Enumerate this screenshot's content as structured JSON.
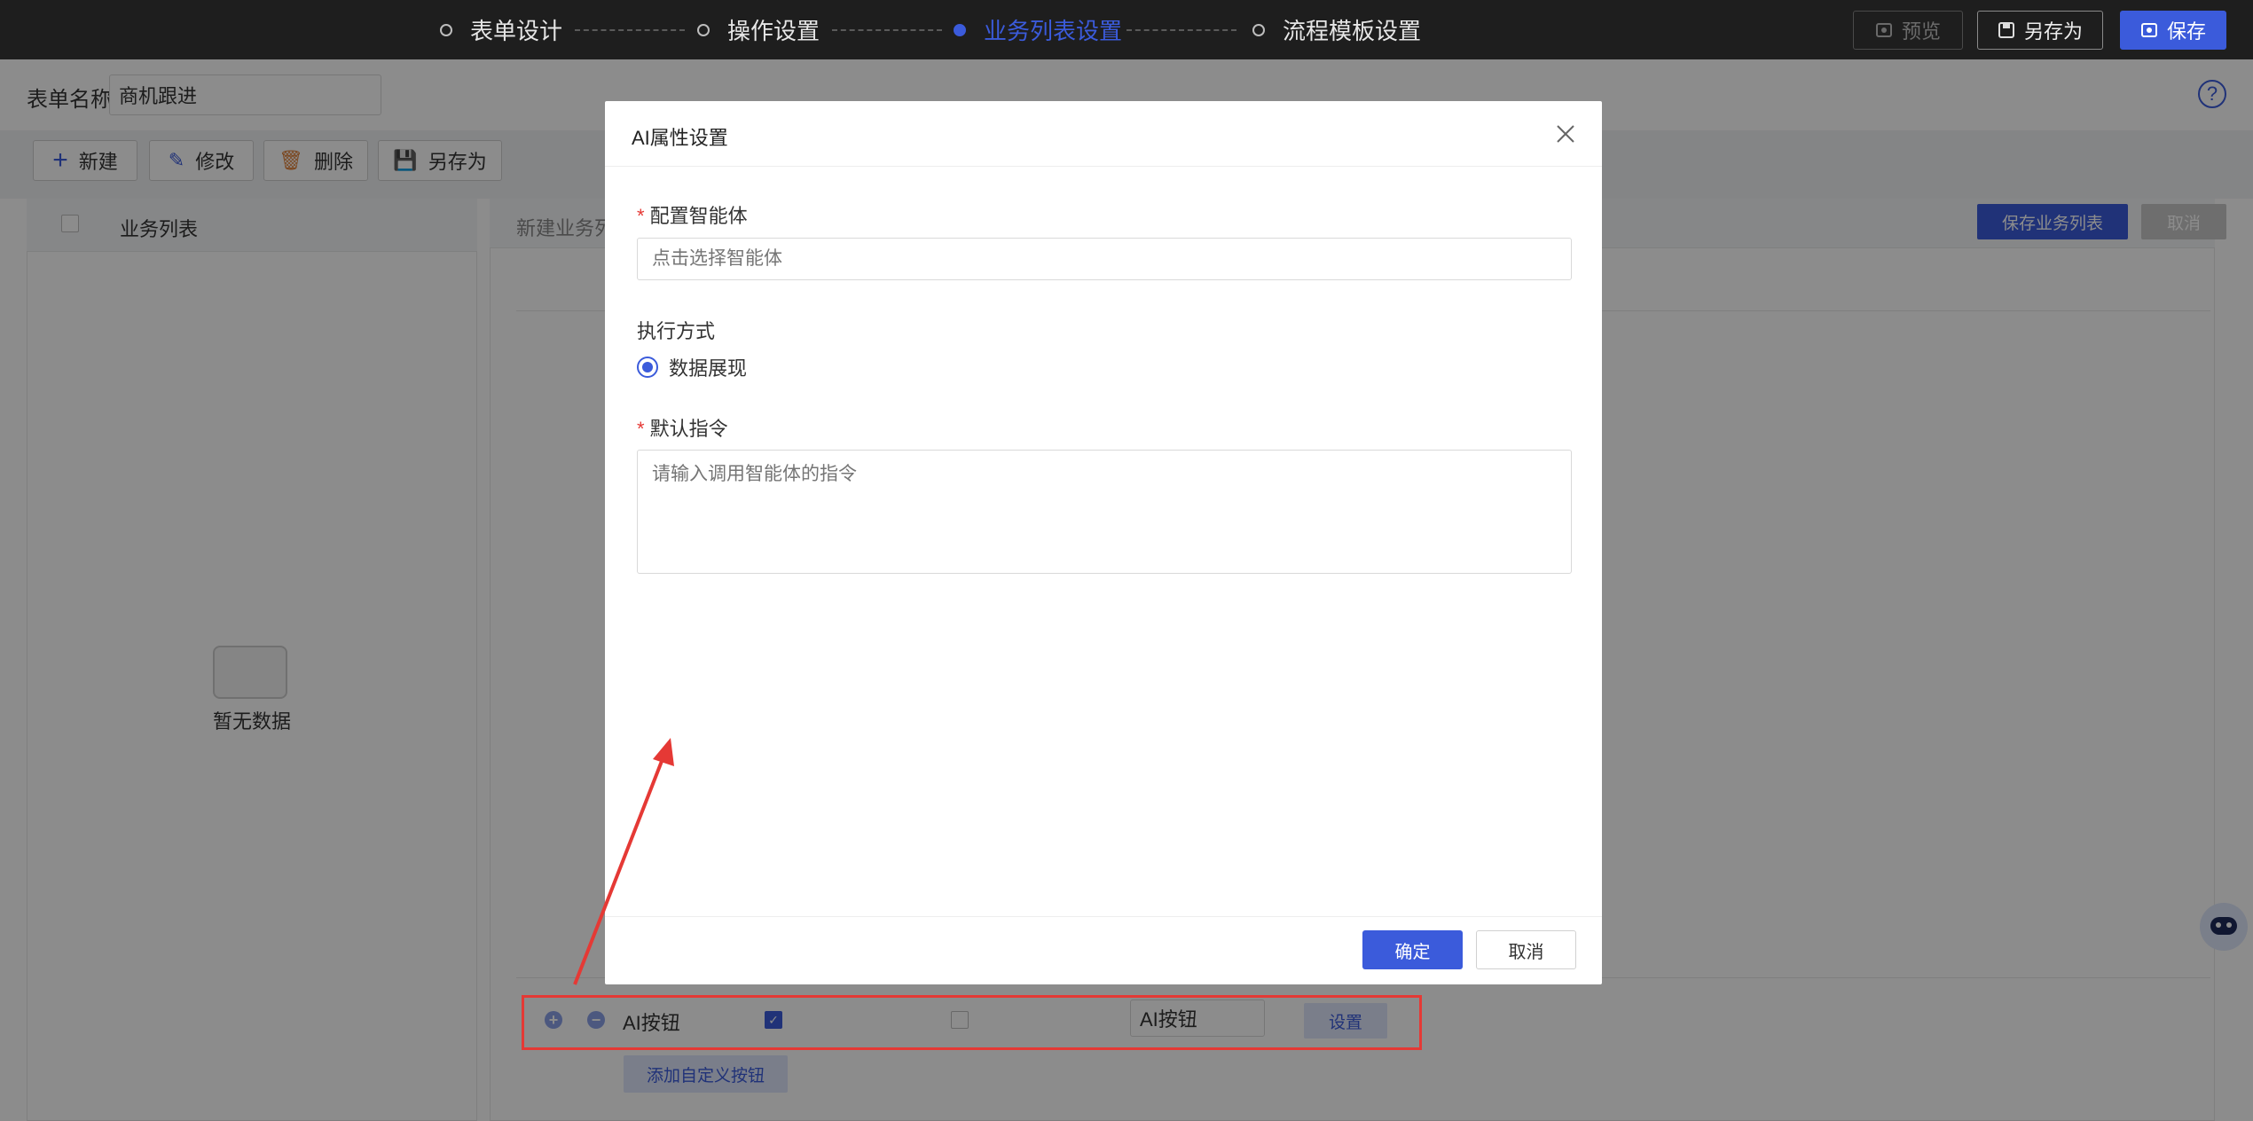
{
  "header": {
    "steps": [
      {
        "label": "表单设计",
        "active": false
      },
      {
        "label": "操作设置",
        "active": false
      },
      {
        "label": "业务列表设置",
        "active": true
      },
      {
        "label": "流程模板设置",
        "active": false
      }
    ],
    "preview_label": "预览",
    "save_as_label": "另存为",
    "save_label": "保存"
  },
  "form": {
    "name_label": "表单名称",
    "name_value": "商机跟进"
  },
  "toolbar": {
    "new_label": "新建",
    "edit_label": "修改",
    "delete_label": "删除",
    "save_as_label": "另存为"
  },
  "left_panel": {
    "header": "业务列表",
    "empty_text": "暂无数据"
  },
  "right_panel": {
    "title_partial": "新建业务列",
    "save_list_label": "保存业务列表",
    "cancel_label": "取消"
  },
  "custom_button_row": {
    "name": "AI按钮",
    "checked_1": true,
    "checked_2": false,
    "input_value": "AI按钮",
    "settings_label": "设置",
    "add_custom_label": "添加自定义按钮"
  },
  "modal": {
    "title": "AI属性设置",
    "agent_label": "配置智能体",
    "agent_placeholder": "点击选择智能体",
    "exec_label": "执行方式",
    "exec_option": "数据展现",
    "instruction_label": "默认指令",
    "instruction_placeholder": "请输入调用智能体的指令",
    "ok_label": "确定",
    "cancel_label": "取消",
    "required_mark": "*"
  },
  "colors": {
    "primary": "#3b5bdb",
    "annotation_red": "#e53935",
    "topbar": "#1e1e1e"
  }
}
